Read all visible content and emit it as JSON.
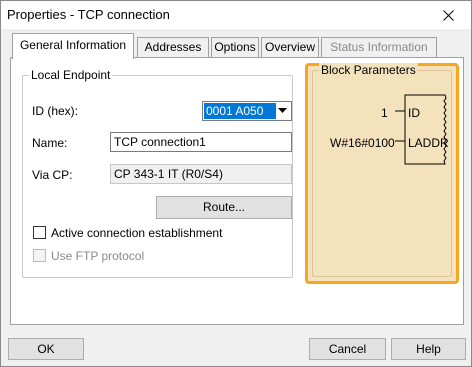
{
  "window": {
    "title": "Properties - TCP connection"
  },
  "tabs": [
    {
      "label": "General Information"
    },
    {
      "label": "Addresses"
    },
    {
      "label": "Options"
    },
    {
      "label": "Overview"
    },
    {
      "label": "Status Information"
    }
  ],
  "local_endpoint": {
    "legend": "Local Endpoint",
    "id_label": "ID (hex):",
    "id_value": "0001 A050",
    "name_label": "Name:",
    "name_value": "TCP connection1",
    "via_cp_label": "Via CP:",
    "via_cp_value": "CP 343-1 IT (R0/S4)",
    "route_label": "Route..."
  },
  "options": {
    "active_connection_label": "Active connection establishment",
    "active_connection_checked": false,
    "ftp_label": "Use FTP protocol",
    "ftp_checked": false
  },
  "block_parameters": {
    "legend": "Block Parameters",
    "id_input": "1",
    "id_pin": "ID",
    "laddr_input": "W#16#0100",
    "laddr_pin": "LADDR",
    "highlight_color": "#f5a623",
    "background_color": "#f4e2bd"
  },
  "buttons": {
    "ok": "OK",
    "cancel": "Cancel",
    "help": "Help"
  }
}
